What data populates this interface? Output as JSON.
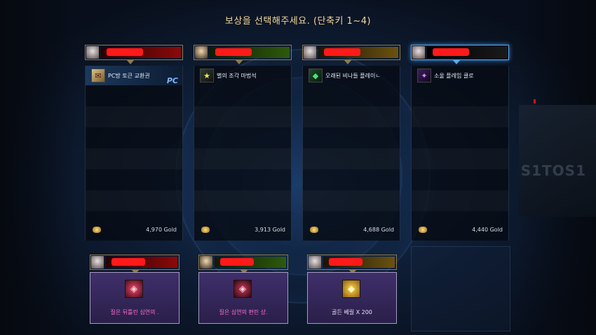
{
  "title": "보상을 선택해주세요. (단축키 1~4)",
  "colors": {
    "title": "#f2d89a",
    "pc_tag": "#7fb4ff",
    "bonus_label_pink": "#ff6fd0",
    "redaction": "#ff1a1a",
    "selected_border": "#5aa8e8"
  },
  "columns": [
    {
      "theme": "red",
      "reward_name": "PC방 토큰 교환권",
      "icon": "ticket-icon",
      "tag": "PC",
      "gold": "4,970 Gold"
    },
    {
      "theme": "green",
      "reward_name": "별의 조각 마법석",
      "icon": "star-icon",
      "tag": "",
      "gold": "3,913 Gold"
    },
    {
      "theme": "gold",
      "reward_name": "오래된 비나들 플레이ㄴ",
      "icon": "gem-icon",
      "tag": "",
      "gold": "4,688 Gold"
    },
    {
      "theme": "blue",
      "reward_name": "소울 플레임 클로",
      "icon": "claw-icon",
      "tag": "",
      "gold": "4,440 Gold"
    }
  ],
  "bonus": [
    {
      "label": "질은 뒤틀린 심연의 .",
      "icon": "crystal-icon"
    },
    {
      "label": "질은 심연의 편린 상.",
      "icon": "crystal-icon"
    },
    {
      "label": "골든 베릴 X 200",
      "icon": "gold-gem-icon"
    }
  ],
  "background": {
    "watermark": "S1TOS1"
  }
}
